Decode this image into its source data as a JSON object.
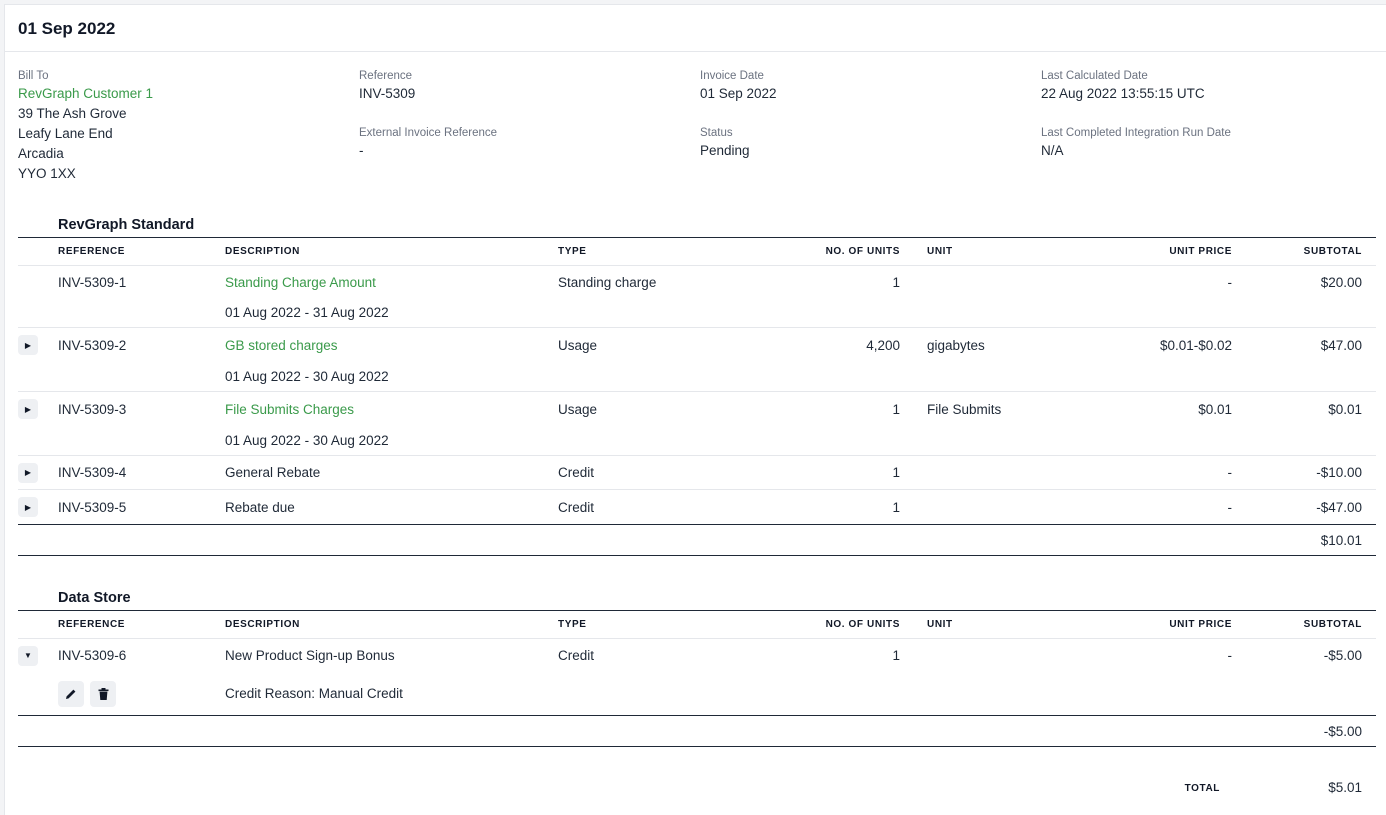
{
  "header": {
    "title": "01 Sep 2022"
  },
  "info": {
    "bill_to_label": "Bill To",
    "customer": "RevGraph Customer 1",
    "address": [
      "39 The Ash Grove",
      "Leafy Lane End",
      "Arcadia",
      "YYO 1XX"
    ],
    "reference_label": "Reference",
    "reference": "INV-5309",
    "ext_ref_label": "External Invoice Reference",
    "ext_ref": "-",
    "invoice_date_label": "Invoice Date",
    "invoice_date": "01 Sep 2022",
    "status_label": "Status",
    "status": "Pending",
    "last_calc_label": "Last Calculated Date",
    "last_calc": "22 Aug 2022 13:55:15 UTC",
    "last_integ_label": "Last Completed Integration Run Date",
    "last_integ": "N/A"
  },
  "columns": {
    "reference": "REFERENCE",
    "description": "DESCRIPTION",
    "type": "TYPE",
    "units": "NO. OF UNITS",
    "unit": "UNIT",
    "unit_price": "UNIT PRICE",
    "subtotal": "SUBTOTAL"
  },
  "sections": [
    {
      "title": "RevGraph Standard",
      "rows": [
        {
          "ref": "INV-5309-1",
          "desc": "Standing Charge Amount",
          "period": "01 Aug 2022 - 31 Aug 2022",
          "type": "Standing charge",
          "units": "1",
          "unit": "",
          "price": "-",
          "subtotal": "$20.00"
        },
        {
          "ref": "INV-5309-2",
          "desc": "GB stored charges",
          "period": "01 Aug 2022 - 30 Aug 2022",
          "type": "Usage",
          "units": "4,200",
          "unit": "gigabytes",
          "price": "$0.01-$0.02",
          "subtotal": "$47.00"
        },
        {
          "ref": "INV-5309-3",
          "desc": "File Submits Charges",
          "period": "01 Aug 2022 - 30 Aug 2022",
          "type": "Usage",
          "units": "1",
          "unit": "File Submits",
          "price": "$0.01",
          "subtotal": "$0.01"
        },
        {
          "ref": "INV-5309-4",
          "desc": "General Rebate",
          "type": "Credit",
          "units": "1",
          "unit": "",
          "price": "-",
          "subtotal": "-$10.00"
        },
        {
          "ref": "INV-5309-5",
          "desc": "Rebate due",
          "type": "Credit",
          "units": "1",
          "unit": "",
          "price": "-",
          "subtotal": "-$47.00"
        }
      ],
      "sum": "$10.01"
    },
    {
      "title": "Data Store",
      "rows": [
        {
          "ref": "INV-5309-6",
          "desc": "New Product Sign-up Bonus",
          "reason": "Credit Reason: Manual Credit",
          "type": "Credit",
          "units": "1",
          "unit": "",
          "price": "-",
          "subtotal": "-$5.00"
        }
      ],
      "sum": "-$5.00"
    }
  ],
  "total": {
    "label": "TOTAL",
    "value": "$5.01"
  },
  "colors": {
    "link": "#3a9a4a",
    "rule": "#1f2937"
  }
}
